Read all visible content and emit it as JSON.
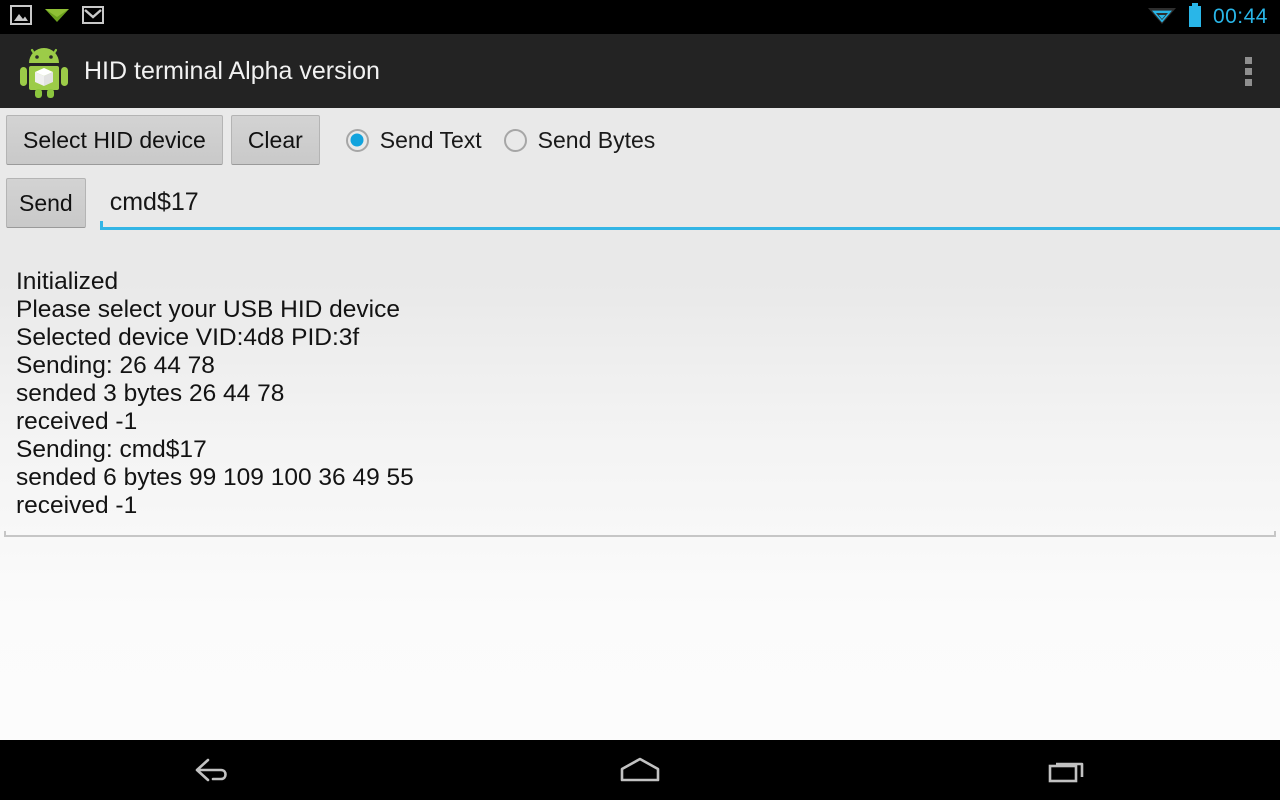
{
  "statusbar": {
    "icons": [
      "gallery-icon",
      "downloads-icon",
      "gmail-icon"
    ],
    "wifi_icon": "wifi-icon",
    "battery_icon": "battery-icon",
    "clock": "00:44",
    "accent_color": "#29b6e8"
  },
  "actionbar": {
    "app_icon": "android-app-icon",
    "title": "HID terminal Alpha version",
    "overflow_label": "overflow-menu"
  },
  "toolbar": {
    "select_device_label": "Select HID device",
    "clear_label": "Clear",
    "radios": [
      {
        "label": "Send Text",
        "checked": true
      },
      {
        "label": "Send Bytes",
        "checked": false
      }
    ]
  },
  "send_row": {
    "send_label": "Send",
    "input_value": "cmd$17",
    "input_placeholder": "",
    "underline_color": "#33b5e5"
  },
  "log": {
    "lines": [
      "Initialized",
      "Please select your USB HID device",
      "Selected device VID:4d8 PID:3f",
      "Sending: 26 44 78",
      "sended 3 bytes 26 44 78",
      "received -1",
      "Sending: cmd$17",
      "sended 6 bytes 99 109 100 36 49 55",
      "received -1"
    ]
  },
  "navbar": {
    "back_label": "back-button",
    "home_label": "home-button",
    "recents_label": "recents-button"
  }
}
